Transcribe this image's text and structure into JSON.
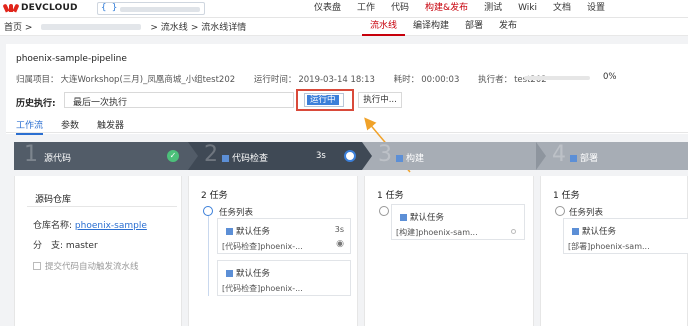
{
  "brand": {
    "name": "DEVCLOUD",
    "color": "#e1251b"
  },
  "project_selector": {
    "icon": "code-braces-icon",
    "glyph": "{ }"
  },
  "nav": {
    "items": [
      {
        "label": "仪表盘",
        "active": false
      },
      {
        "label": "工作",
        "active": false
      },
      {
        "label": "代码",
        "active": false
      },
      {
        "label": "构建&发布",
        "active": true
      },
      {
        "label": "测试",
        "active": false
      },
      {
        "label": "Wiki",
        "active": false
      },
      {
        "label": "文档",
        "active": false
      },
      {
        "label": "设置",
        "active": false
      }
    ]
  },
  "breadcrumb": {
    "home": "首页 >",
    "level2": "> 流水线",
    "level3": "> 流水线详情"
  },
  "subtabs": [
    {
      "label": "流水线",
      "active": true
    },
    {
      "label": "编译构建",
      "active": false
    },
    {
      "label": "部署",
      "active": false
    },
    {
      "label": "发布",
      "active": false
    }
  ],
  "pipeline": {
    "name": "phoenix-sample-pipeline",
    "project_label": "归属项目：",
    "project_value": "大连Workshop(三月)_凤凰商城_小组test202",
    "run_time_label": "运行时间：",
    "run_time_value": "2019-03-14 18:13",
    "duration_label": "耗时：",
    "duration_value": "00:00:03",
    "executor_label": "执行者：",
    "executor_value": "test202",
    "progress_percent": 0,
    "progress_text": "0%"
  },
  "history": {
    "label": "历史执行:",
    "selected": "最后一次执行",
    "status": "运行中",
    "exec_button": "执行中..."
  },
  "tabs": [
    {
      "label": "工作流",
      "active": true
    },
    {
      "label": "参数",
      "active": false
    },
    {
      "label": "触发器",
      "active": false
    }
  ],
  "stages": [
    {
      "num": "1",
      "name": "源代码",
      "time": "",
      "status": "done"
    },
    {
      "num": "2",
      "name": "代码检查",
      "time": "3s",
      "status": "running"
    },
    {
      "num": "3",
      "name": "构建",
      "time": "",
      "status": "pending"
    },
    {
      "num": "4",
      "name": "部署",
      "time": "",
      "status": "pending"
    }
  ],
  "source": {
    "title": "源码仓库",
    "repo_label": "仓库名称:",
    "repo_value": "phoenix-sample",
    "branch_label": "分　支:",
    "branch_value": "master",
    "trigger_label": "提交代码自动触发流水线"
  },
  "code_check": {
    "count": "2 任务",
    "group": "任务列表",
    "task1_name": "默认任务",
    "task1_time": "3s",
    "task1_sub": "[代码检查]phoenix-...",
    "task2_name": "默认任务",
    "task2_sub": "[代码检查]phoenix-..."
  },
  "build": {
    "count": "1 任务",
    "task_name": "默认任务",
    "task_sub": "[构建]phoenix-sam..."
  },
  "deploy": {
    "count": "1 任务",
    "group": "任务列表",
    "task_name": "默认任务",
    "task_sub": "[部署]phoenix-sam..."
  },
  "colors": {
    "accent_red": "#c7000b",
    "accent_blue": "#2b6fd1",
    "success": "#4cc07a",
    "arrow": "#f0a22a"
  }
}
